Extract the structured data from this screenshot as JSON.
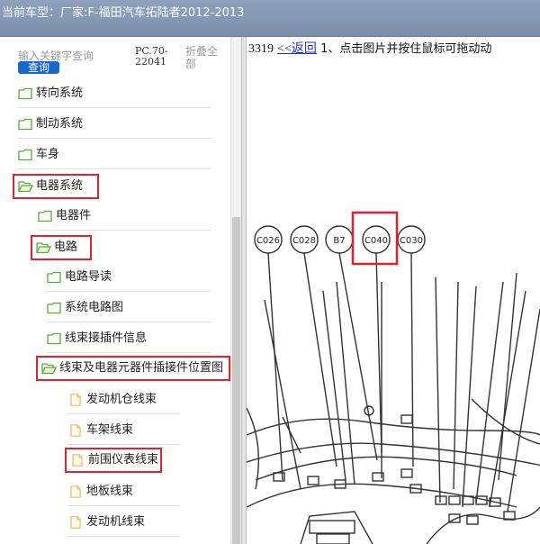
{
  "titlebar": {
    "label": "当前车型：",
    "vehicle": "厂家:F-福田汽车拓陆者2012-2013"
  },
  "sidebar": {
    "search_placeholder": "输入关键字查询",
    "search_button": "查询",
    "pc_code": "PC.70-22041",
    "collapse_all": "折叠全部",
    "tree": [
      {
        "label": "转向系统",
        "icon": "folder-icon"
      },
      {
        "label": "制动系统",
        "icon": "folder-icon"
      },
      {
        "label": "车身",
        "icon": "folder-icon"
      },
      {
        "label": "电器系统",
        "icon": "folder-open-icon"
      },
      {
        "label": "电器件",
        "icon": "folder-icon"
      },
      {
        "label": "电路",
        "icon": "folder-open-icon"
      },
      {
        "label": "电路导读",
        "icon": "folder-icon"
      },
      {
        "label": "系统电路图",
        "icon": "folder-icon"
      },
      {
        "label": "线束接插件信息",
        "icon": "folder-icon"
      },
      {
        "label": "线束及电器元器件插接件位置图",
        "icon": "folder-open-icon"
      },
      {
        "label": "发动机仓线束",
        "icon": "document-icon"
      },
      {
        "label": "车架线束",
        "icon": "document-icon"
      },
      {
        "label": "前围仪表线束",
        "icon": "document-icon"
      },
      {
        "label": "地板线束",
        "icon": "document-icon"
      },
      {
        "label": "发动机线束",
        "icon": "document-icon"
      }
    ]
  },
  "content": {
    "code": "3319",
    "back_link": "<<返回",
    "instruction": "1、点击图片并按住鼠标可拖动动",
    "connectors": [
      "C026",
      "C028",
      "B7",
      "C040",
      "C030"
    ]
  },
  "colors": {
    "highlight": "#e0222a",
    "folder": "#5cab3a",
    "document": "#f0b860",
    "link": "#2233cc",
    "button": "#1769c7"
  }
}
